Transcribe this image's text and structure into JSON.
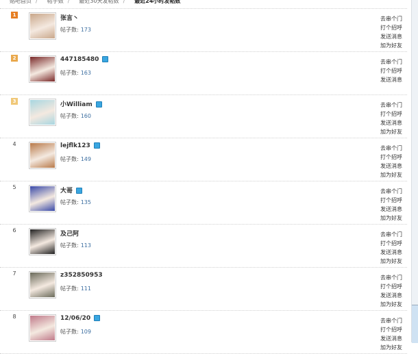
{
  "breadcrumb": [
    "贴吧首页",
    "帖子数",
    "最近30天发帖数",
    "最近24小时发帖数"
  ],
  "rows": [
    {
      "rank": "1",
      "badge": true,
      "name": "张言丶",
      "vip": false,
      "posts_label": "帖子数:",
      "posts": "173",
      "actions": [
        "去串个门",
        "打个招呼",
        "发送消息",
        "加为好友"
      ],
      "avatar_color": "#c9a78a"
    },
    {
      "rank": "2",
      "badge": true,
      "name": "447185480",
      "vip": true,
      "posts_label": "帖子数:",
      "posts": "163",
      "actions": [
        "去串个门",
        "打个招呼",
        "发送消息"
      ],
      "avatar_color": "#7a2a2a"
    },
    {
      "rank": "3",
      "badge": true,
      "name": "小William",
      "vip": true,
      "posts_label": "帖子数:",
      "posts": "160",
      "actions": [
        "去串个门",
        "打个招呼",
        "发送消息",
        "加为好友"
      ],
      "avatar_color": "#a8d6e0"
    },
    {
      "rank": "4",
      "badge": false,
      "name": "lejflk123",
      "vip": true,
      "posts_label": "帖子数:",
      "posts": "149",
      "actions": [
        "去串个门",
        "打个招呼",
        "发送消息",
        "加为好友"
      ],
      "avatar_color": "#b87a4a"
    },
    {
      "rank": "5",
      "badge": false,
      "name": "大哥",
      "vip": true,
      "posts_label": "帖子数:",
      "posts": "135",
      "actions": [
        "去串个门",
        "打个招呼",
        "发送消息",
        "加为好友"
      ],
      "avatar_color": "#3a4aa8"
    },
    {
      "rank": "6",
      "badge": false,
      "name": "及己阿",
      "vip": false,
      "posts_label": "帖子数:",
      "posts": "113",
      "actions": [
        "去串个门",
        "打个招呼",
        "发送消息",
        "加为好友"
      ],
      "avatar_color": "#222222"
    },
    {
      "rank": "7",
      "badge": false,
      "name": "z352850953",
      "vip": false,
      "posts_label": "帖子数:",
      "posts": "111",
      "actions": [
        "去串个门",
        "打个招呼",
        "发送消息",
        "加为好友"
      ],
      "avatar_color": "#6a6a5a"
    },
    {
      "rank": "8",
      "badge": false,
      "name": "12/06/20",
      "vip": true,
      "posts_label": "帖子数:",
      "posts": "109",
      "actions": [
        "去串个门",
        "打个招呼",
        "发送消息",
        "加为好友"
      ],
      "avatar_color": "#c07a8a"
    }
  ]
}
